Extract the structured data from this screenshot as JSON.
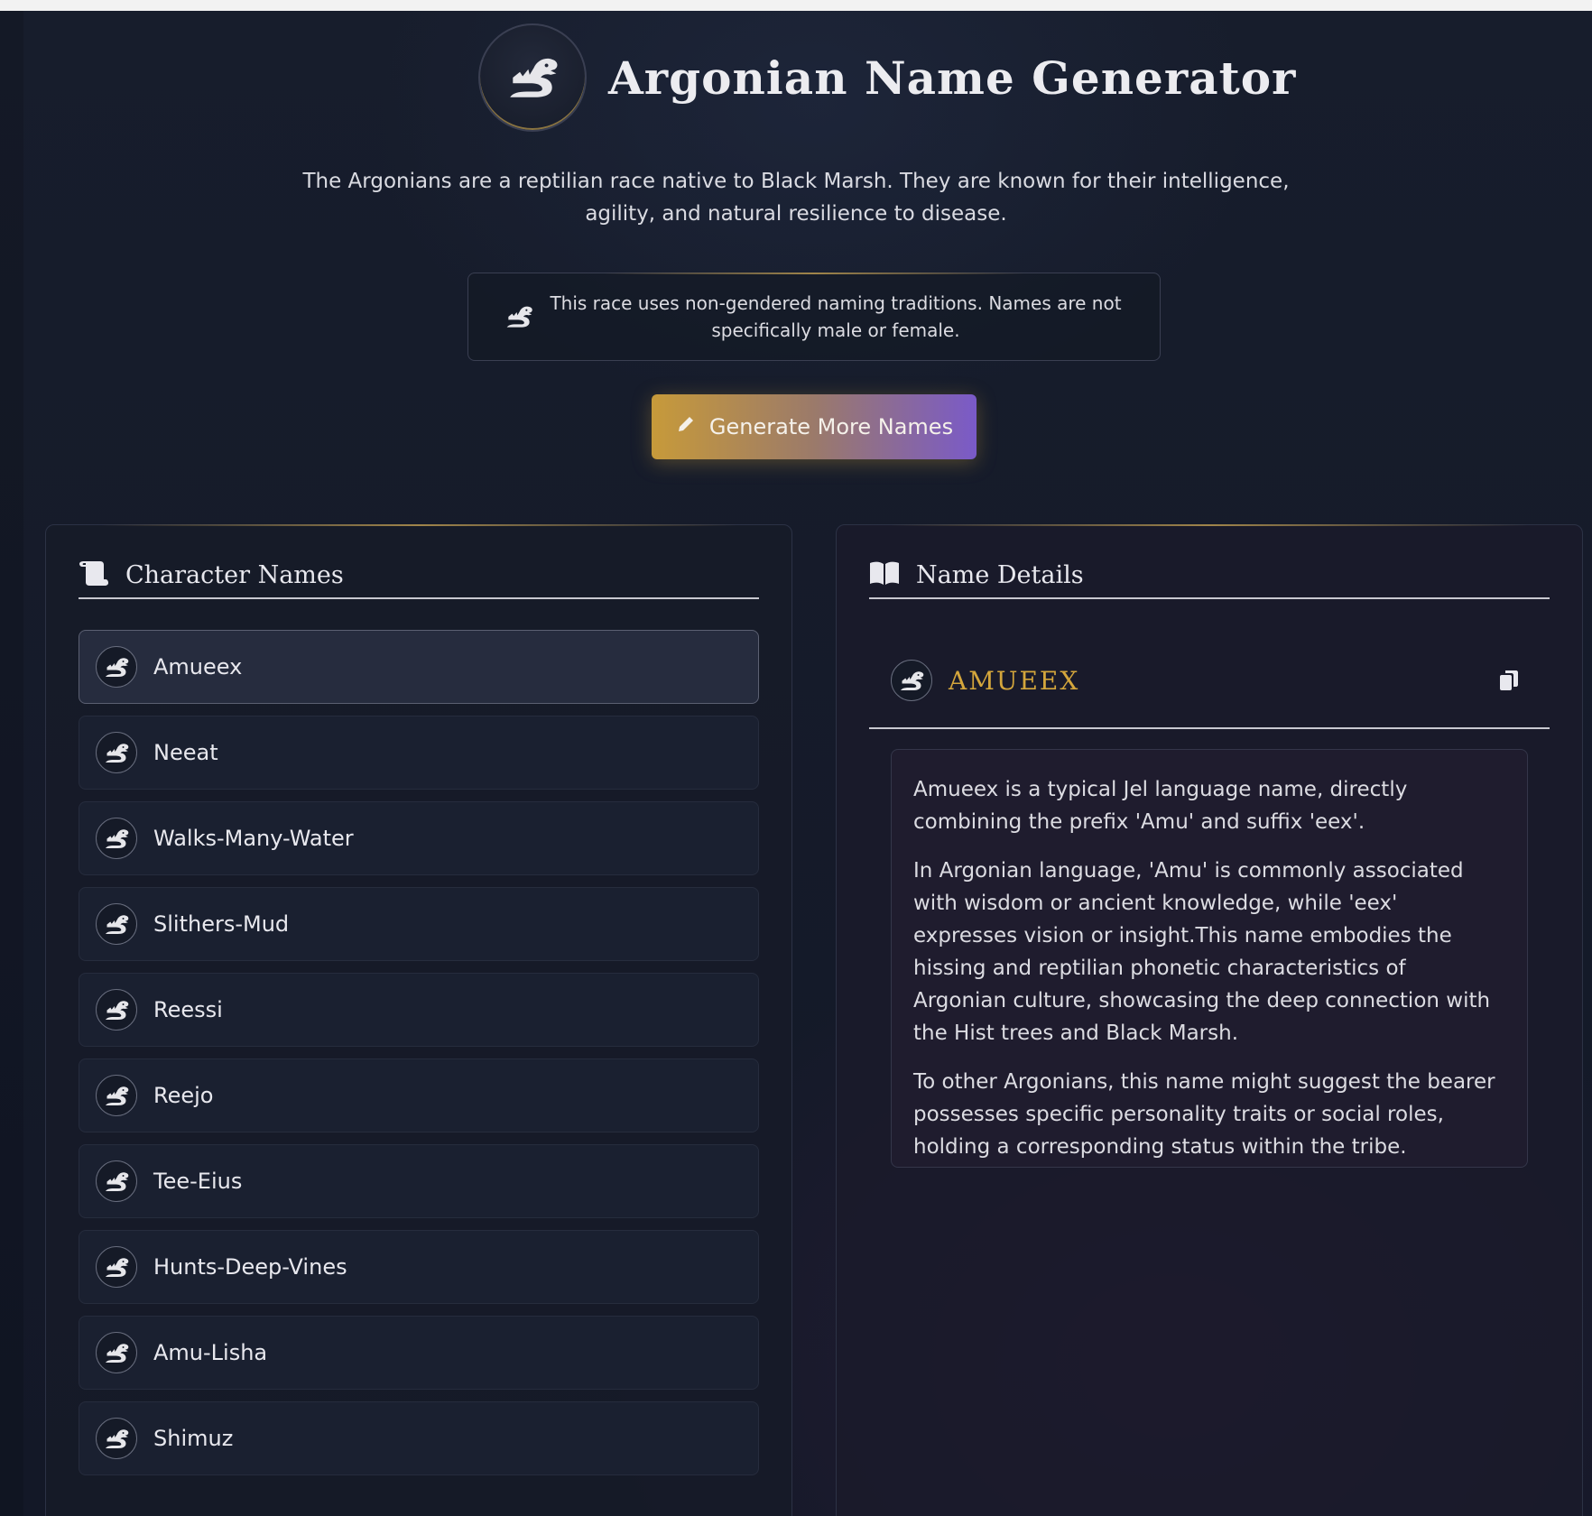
{
  "header": {
    "title": "Argonian Name Generator"
  },
  "intro": "The Argonians are a reptilian race native to Black Marsh. They are known for their intelligence, agility, and natural resilience to disease.",
  "notice": "This race uses non-gendered naming traditions. Names are not specifically male or female.",
  "generate_button": {
    "label": "Generate More Names"
  },
  "names_panel": {
    "title": "Character Names",
    "items": [
      {
        "label": "Amueex",
        "selected": true
      },
      {
        "label": "Neeat"
      },
      {
        "label": "Walks-Many-Water"
      },
      {
        "label": "Slithers-Mud"
      },
      {
        "label": "Reessi"
      },
      {
        "label": "Reejo"
      },
      {
        "label": "Tee-Eius"
      },
      {
        "label": "Hunts-Deep-Vines"
      },
      {
        "label": "Amu-Lisha"
      },
      {
        "label": "Shimuz"
      }
    ]
  },
  "details_panel": {
    "title": "Name Details",
    "name": "AMUEEX",
    "paragraphs": [
      "Amueex is a typical Jel language name, directly combining the prefix 'Amu' and suffix 'eex'.",
      "In Argonian language, 'Amu' is commonly associated with wisdom or ancient knowledge, while 'eex' expresses vision or insight.This name embodies the hissing and reptilian phonetic characteristics of Argonian culture, showcasing the deep connection with the Hist trees and Black Marsh.",
      "To other Argonians, this name might suggest the bearer possesses specific personality traits or social roles, holding a corresponding status within the tribe."
    ]
  },
  "icons": {
    "logo": "argonian-dragon-icon",
    "item": "argonian-dragon-icon",
    "names_panel": "scroll-icon",
    "details_panel": "book-open-icon",
    "generate": "pencil-icon",
    "copy": "copy-icon"
  },
  "colors": {
    "accent_gold": "#d4a63c",
    "button_start": "#c79a3a",
    "button_end": "#7a5ac8"
  }
}
